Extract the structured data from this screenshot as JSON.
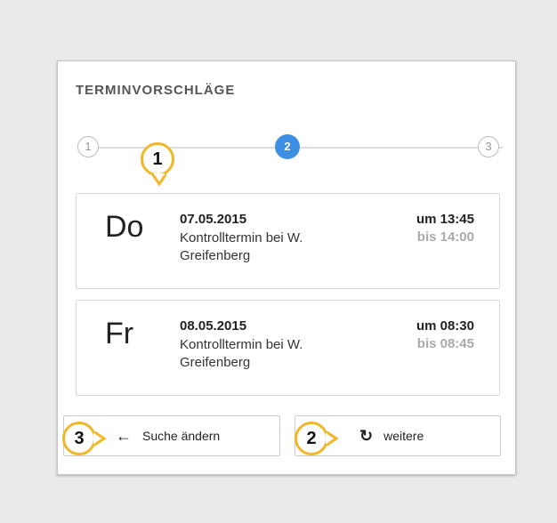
{
  "panel": {
    "title": "TERMINVORSCHLÄGE"
  },
  "steps": [
    "1",
    "2",
    "3"
  ],
  "appointments": [
    {
      "day": "Do",
      "date": "07.05.2015",
      "description": "Kontrolltermin bei W. Greifenberg",
      "from": "um 13:45",
      "to": "bis 14:00"
    },
    {
      "day": "Fr",
      "date": "08.05.2015",
      "description": "Kontrolltermin bei W. Greifenberg",
      "from": "um 08:30",
      "to": "bis 08:45"
    }
  ],
  "buttons": {
    "back": {
      "icon": "arrow-left-icon",
      "label": "Suche ändern"
    },
    "more": {
      "icon": "refresh-icon",
      "label": "weitere"
    }
  },
  "callouts": [
    "1",
    "2",
    "3"
  ],
  "colors": {
    "active_step": "#3c8fe2",
    "callout_border": "#f2b626",
    "background": "#ebebeb"
  }
}
